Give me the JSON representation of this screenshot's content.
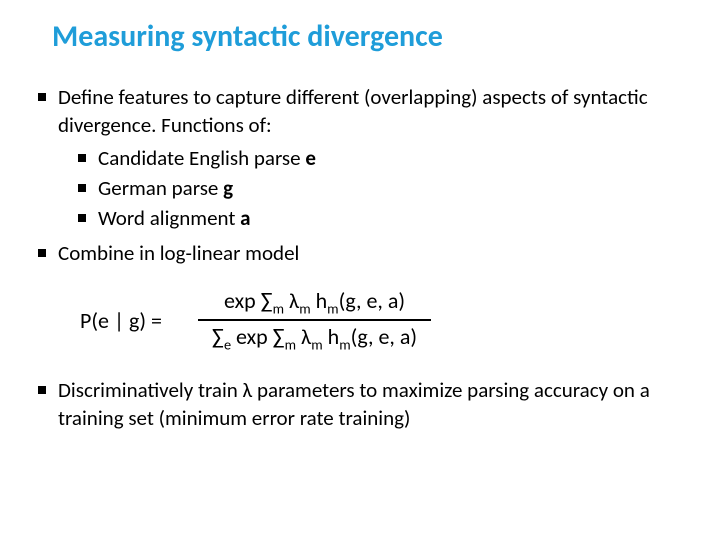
{
  "title": "Measuring syntactic divergence",
  "bullet1_a": "Define features to capture different (overlapping) aspects of syntactic divergence. Functions of:",
  "sub1_a": "Candidate English parse ",
  "sub1_b": "e",
  "sub2_a": "German parse ",
  "sub2_b": "g",
  "sub3_a": "Word alignment ",
  "sub3_b": "a",
  "bullet2": "Combine in log-linear model",
  "formula": {
    "lhs": "P(e | g) =",
    "num_a": "exp ∑",
    "num_b": "m",
    "num_c": " λ",
    "num_d": "m",
    "num_e": " h",
    "num_f": "m",
    "num_g": "(g, e, a)",
    "den_a": "∑",
    "den_b": "e",
    "den_c": " exp ∑",
    "den_d": "m",
    "den_e": " λ",
    "den_f": "m",
    "den_g": " h",
    "den_h": "m",
    "den_i": "(g, e, a)"
  },
  "bullet3": "Discriminatively train λ parameters to maximize parsing accuracy on a training set (minimum error rate training)"
}
